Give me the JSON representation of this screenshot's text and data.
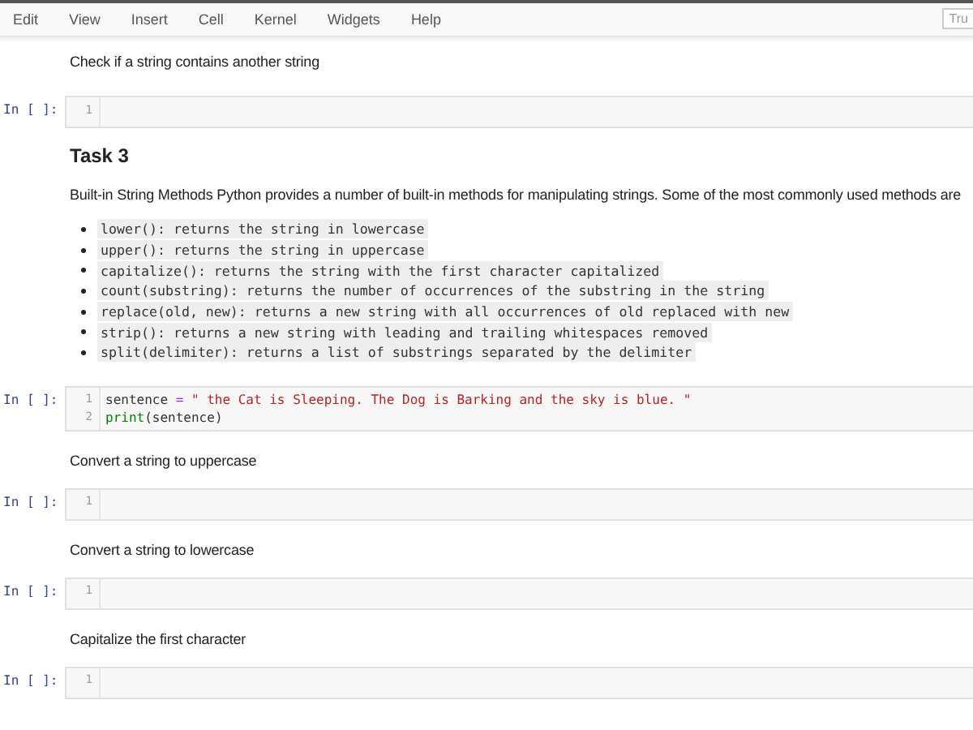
{
  "menu": [
    "Edit",
    "View",
    "Insert",
    "Cell",
    "Kernel",
    "Widgets",
    "Help"
  ],
  "trusted_label": "Tru",
  "cells": [
    {
      "kind": "text",
      "text": "Check if a string contains another string"
    },
    {
      "kind": "code",
      "prompt": "In [ ]:",
      "lines": [
        {
          "number": "1"
        }
      ]
    },
    {
      "kind": "heading",
      "text": "Task 3"
    },
    {
      "kind": "text",
      "text": "Built-in String Methods Python provides a number of built-in methods for manipulating strings. Some of the most commonly used methods are"
    },
    {
      "kind": "list",
      "items": [
        "lower(): returns the string in lowercase",
        "upper(): returns the string in uppercase",
        "capitalize(): returns the string with the first character capitalized",
        "count(substring): returns the number of occurrences of the substring in the string",
        "replace(old, new): returns a new string with all occurrences of old replaced with new",
        "strip(): returns a new string with leading and trailing whitespaces removed",
        "split(delimiter): returns a list of substrings separated by the delimiter"
      ]
    },
    {
      "kind": "code",
      "prompt": "In [ ]:",
      "lines": [
        {
          "number": "1",
          "tokens": [
            {
              "kind": "name",
              "text": "sentence"
            },
            {
              "kind": "operator",
              "text": "="
            },
            {
              "kind": "string",
              "text": "\" the Cat is Sleeping. The Dog is Barking and the sky is blue. \""
            }
          ]
        },
        {
          "number": "2",
          "tokens": [
            {
              "kind": "builtin",
              "text": "print"
            },
            {
              "kind": "name",
              "text": "(sentence)"
            }
          ]
        }
      ]
    },
    {
      "kind": "text",
      "text": "Convert a string to uppercase"
    },
    {
      "kind": "code",
      "prompt": "In [ ]:",
      "lines": [
        {
          "number": "1"
        }
      ]
    },
    {
      "kind": "text",
      "text": "Convert a string to lowercase"
    },
    {
      "kind": "code",
      "prompt": "In [ ]:",
      "lines": [
        {
          "number": "1"
        }
      ]
    },
    {
      "kind": "text",
      "text": "Capitalize the first character"
    },
    {
      "kind": "code",
      "prompt": "In [ ]:",
      "lines": [
        {
          "number": "1"
        }
      ]
    }
  ]
}
